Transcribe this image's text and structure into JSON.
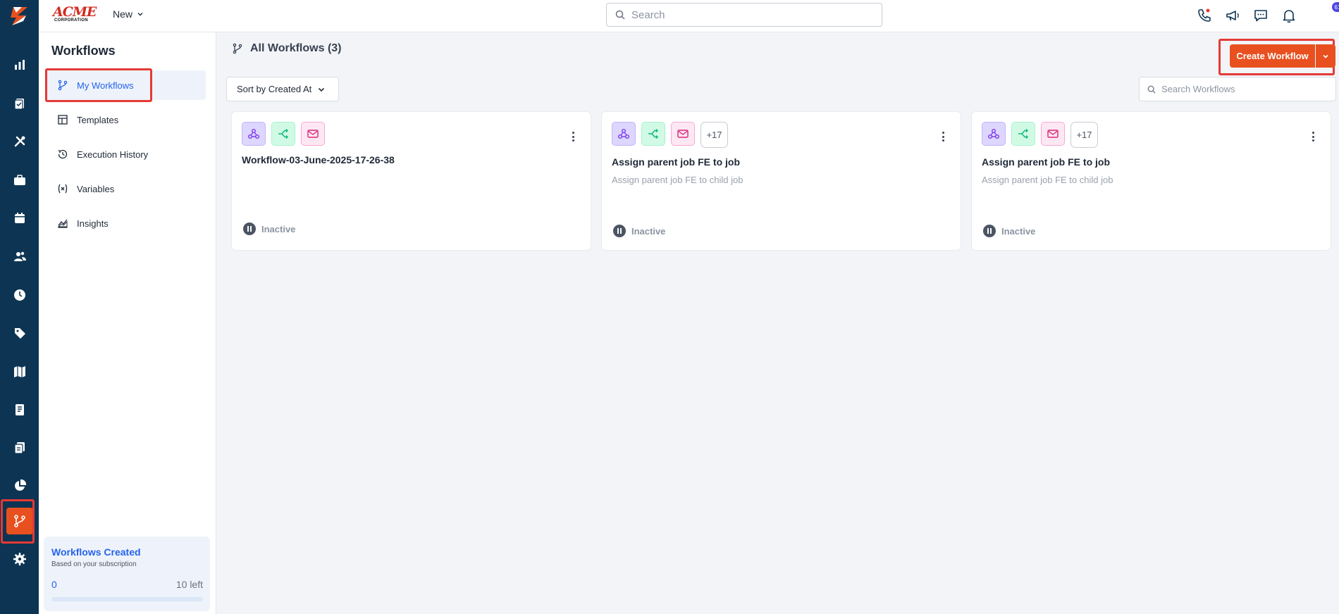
{
  "brand": {
    "name": "ACME",
    "sub": "CORPORATION"
  },
  "topbar": {
    "new_label": "New",
    "search_placeholder": "Search",
    "notification_count": "61"
  },
  "subnav": {
    "title": "Workflows",
    "items": [
      {
        "label": "My Workflows",
        "icon": "workflow-icon",
        "active": true
      },
      {
        "label": "Templates",
        "icon": "templates-icon"
      },
      {
        "label": "Execution History",
        "icon": "history-icon"
      },
      {
        "label": "Variables",
        "icon": "variables-icon"
      },
      {
        "label": "Insights",
        "icon": "insights-icon"
      }
    ],
    "quota": {
      "title": "Workflows Created",
      "subtitle": "Based on your subscription",
      "used": "0",
      "left": "10 left",
      "fraction_used": 0
    }
  },
  "main": {
    "title": "All Workflows (3)",
    "create_label": "Create Workflow",
    "sort_label": "Sort by Created At",
    "search_placeholder": "Search Workflows",
    "cards": [
      {
        "title": "Workflow-03-June-2025-17-26-38",
        "description": "",
        "status": "Inactive",
        "more": ""
      },
      {
        "title": "Assign parent job FE to job",
        "description": "Assign parent job FE to child job",
        "status": "Inactive",
        "more": "+17"
      },
      {
        "title": "Assign parent job FE to job",
        "description": "Assign parent job FE to child job",
        "status": "Inactive",
        "more": "+17"
      }
    ]
  },
  "colors": {
    "rail": "#0d3553",
    "accent": "#e8501f",
    "active_text": "#2563eb",
    "highlight": "#e53935"
  }
}
